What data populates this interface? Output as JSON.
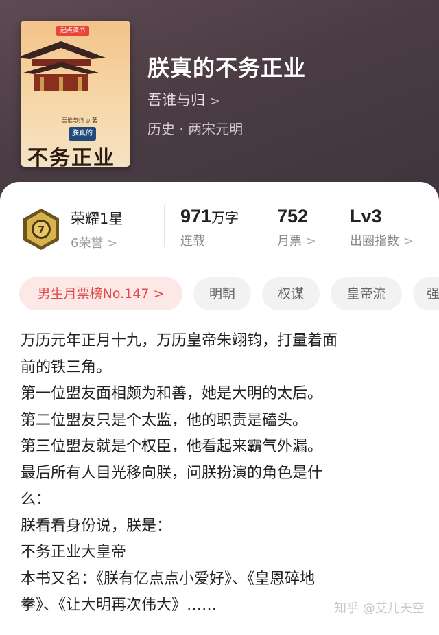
{
  "book": {
    "title": "朕真的不务正业",
    "author": "吾谁与归",
    "author_chevron": ">",
    "genre": "历史 · 两宋元明",
    "cover": {
      "publisher": "起点读书",
      "author_caption": "吾谁与归 ◎ 著",
      "title_small": "朕真的",
      "title_big": "不务正业"
    }
  },
  "stats": {
    "rank_title": "荣耀1星",
    "rank_sub": "6荣誉",
    "words_value": "971",
    "words_unit": "万字",
    "words_label": "连载",
    "votes_value": "752",
    "votes_label": "月票",
    "level_value": "Lv3",
    "level_label": "出圈指数",
    "chevron": ">"
  },
  "tags": [
    "男生月票榜No.147 >",
    "明朝",
    "权谋",
    "皇帝流",
    "强"
  ],
  "description": [
    "万历元年正月十九，万历皇帝朱翊钧，打量着面",
    "前的铁三角。",
    "第一位盟友面相颇为和善，她是大明的太后。",
    "第二位盟友只是个太监，他的职责是磕头。",
    "第三位盟友就是个权臣，他看起来霸气外漏。",
    "最后所有人目光移向朕，问朕扮演的角色是什",
    "么：",
    "朕看看身份说，朕是：",
    "不务正业大皇帝",
    "本书又名：《朕有亿点点小爱好》、《皇恩碎地",
    "拳》、《让大明再次伟大》……"
  ],
  "watermark": "知乎 @艾儿天空",
  "colors": {
    "accent_red": "#e14a4a",
    "hero_bg": "#4b3c44"
  }
}
